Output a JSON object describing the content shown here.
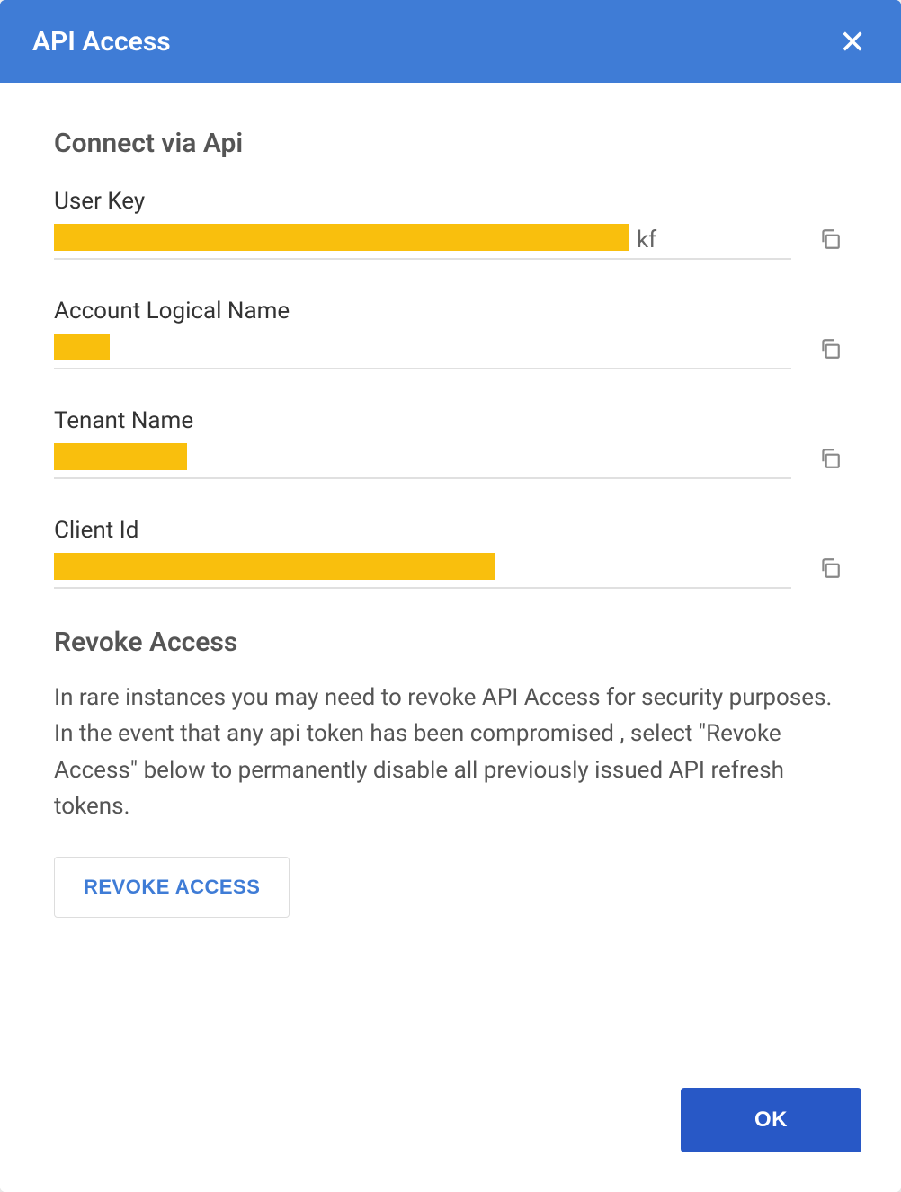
{
  "header": {
    "title": "API Access"
  },
  "connect_section": {
    "title": "Connect via Api",
    "fields": {
      "user_key": {
        "label": "User Key",
        "value_suffix": "kf",
        "redact_width": 640
      },
      "account_logical_name": {
        "label": "Account Logical Name",
        "value_suffix": "",
        "redact_width": 62
      },
      "tenant_name": {
        "label": "Tenant Name",
        "value_suffix": "",
        "redact_width": 148
      },
      "client_id": {
        "label": "Client Id",
        "value_suffix": "",
        "redact_width": 490
      }
    }
  },
  "revoke_section": {
    "title": "Revoke Access",
    "description": "In rare instances you may need to revoke API Access for security purposes. In the event that any api token has been compromised , select \"Revoke Access\" below to permanently disable all previously issued API refresh tokens.",
    "button_label": "REVOKE ACCESS"
  },
  "footer": {
    "ok_label": "OK"
  }
}
